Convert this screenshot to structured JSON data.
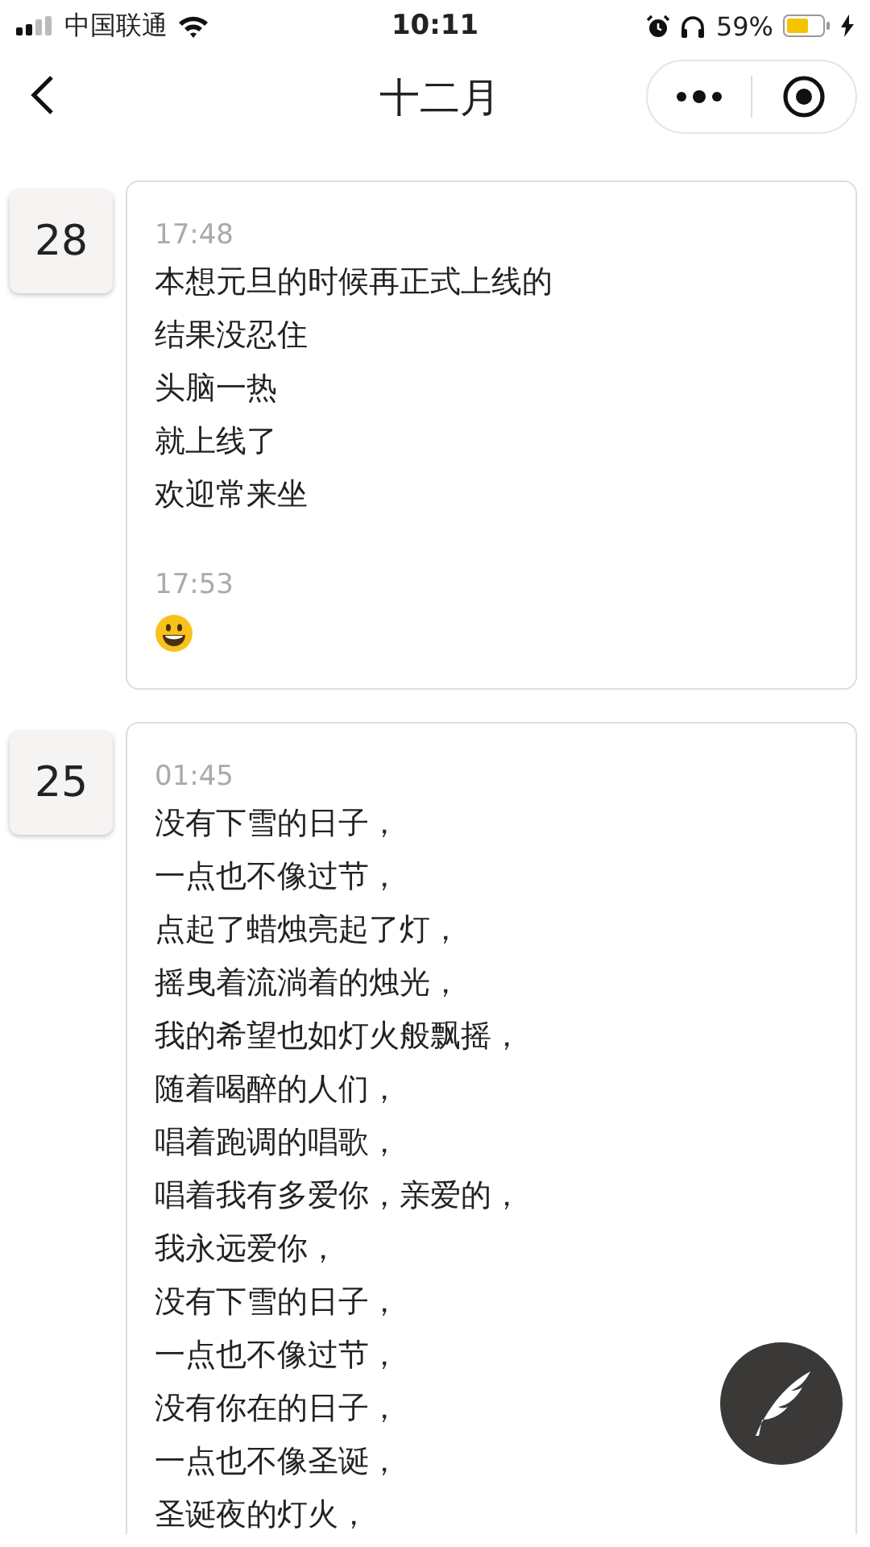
{
  "status_bar": {
    "carrier": "中国联通",
    "time": "10:11",
    "battery": "59%"
  },
  "nav": {
    "title": "十二月"
  },
  "days": [
    {
      "day": "28",
      "posts": [
        {
          "kind": "text",
          "time": "17:48",
          "lines": [
            "本想元旦的时候再正式上线的",
            "结果没忍住",
            "头脑一热",
            "就上线了",
            "欢迎常来坐"
          ]
        },
        {
          "kind": "emoji",
          "time": "17:53"
        }
      ]
    },
    {
      "day": "25",
      "posts": [
        {
          "kind": "text",
          "time": "01:45",
          "lines": [
            "没有下雪的日子，",
            "一点也不像过节，",
            "点起了蜡烛亮起了灯，",
            "摇曳着流淌着的烛光，",
            "我的希望也如灯火般飘摇，",
            "随着喝醉的人们，",
            "唱着跑调的唱歌，",
            "唱着我有多爱你，亲爱的，",
            "我永远爱你，",
            "没有下雪的日子，",
            "一点也不像过节，",
            "没有你在的日子，",
            "一点也不像圣诞，",
            "圣诞夜的灯火，"
          ]
        }
      ]
    }
  ]
}
